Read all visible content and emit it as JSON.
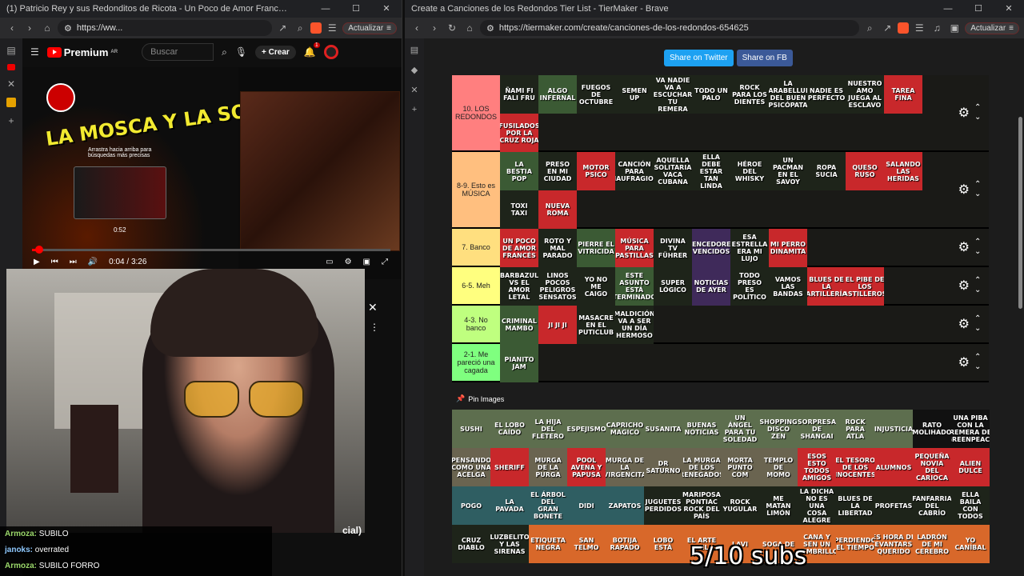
{
  "left_window": {
    "title": "(1) Patricio Rey y sus Redonditos de Ricota - Un Poco de Amor Frances (Audio Oficial) - YouTube - Brave",
    "url": "https://ww...",
    "update_label": "Actualizar",
    "yt": {
      "premium_label": "Premium",
      "premium_region": "AR",
      "search_placeholder": "Buscar",
      "create_label": "Crear",
      "notif_count": "1",
      "video_title_art": "LA MOSCA Y LA SOPA",
      "tooltip": "Arrastra hacia arriba para búsquedas más precisas",
      "preview_time": "0:52",
      "time": "0:04 / 3:26",
      "progress": 0.02,
      "side_official": "cial)"
    },
    "chat": [
      {
        "user": "Armoza:",
        "msg": "SUBILO"
      },
      {
        "user": "janoks:",
        "msg": "overrated"
      },
      {
        "user": "Armoza:",
        "msg": "SUBILO FORRO"
      }
    ]
  },
  "right_window": {
    "title": "Create a Canciones de los Redondos Tier List - TierMaker - Brave",
    "url": "https://tiermaker.com/create/canciones-de-los-redondos-654625",
    "update_label": "Actualizar",
    "share_twitter": "Share on Twitter",
    "share_fb": "Share on FB",
    "pin_label": "Pin Images",
    "overlay_text": "5/10 subs",
    "tiers": [
      {
        "label": "10. LOS REDONDOS",
        "color": "#ff7f7f",
        "height": 96,
        "items": [
          {
            "t": "ÑAMI FI FALI FRU",
            "c": "t-dark"
          },
          {
            "t": "ALGO INFERNAL",
            "c": "t-jungle"
          },
          {
            "t": "FUEGOS DE OCTUBRE",
            "c": "t-dark"
          },
          {
            "t": "SEMEN UP",
            "c": "t-dark"
          },
          {
            "t": "VA NADIE VA A ESCUCHAR TU REMERA",
            "c": "t-dark"
          },
          {
            "t": "TODO UN PALO",
            "c": "t-dark"
          },
          {
            "t": "ROCK PARA LOS DIENTES",
            "c": "t-dark"
          },
          {
            "t": "LA PARABELLUM DEL BUEN PSICÓPATA",
            "c": "t-dark"
          },
          {
            "t": "NADIE ES PERFECTO",
            "c": "t-dark"
          },
          {
            "t": "NUESTRO AMO JUEGA AL ESCLAVO",
            "c": "t-dark"
          },
          {
            "t": "TAREA FINA",
            "c": "t-red"
          },
          {
            "t": "FUSILADOS POR LA CRUZ ROJA",
            "c": "t-red"
          }
        ]
      },
      {
        "label": "8-9. Esto es MÚSICA",
        "color": "#ffbf7f",
        "height": 96,
        "items": [
          {
            "t": "LA BESTIA POP",
            "c": "t-jungle"
          },
          {
            "t": "PRESO EN MI CIUDAD",
            "c": "t-dark"
          },
          {
            "t": "MOTOR PSICO",
            "c": "t-red"
          },
          {
            "t": "CANCIÓN PARA NAUFRAGIOS",
            "c": "t-dark"
          },
          {
            "t": "AQUELLA SOLITARIA VACA CUBANA",
            "c": "t-dark"
          },
          {
            "t": "ELLA DEBE ESTAR TAN LINDA",
            "c": "t-dark"
          },
          {
            "t": "HÉROE DEL WHISKY",
            "c": "t-dark"
          },
          {
            "t": "UN PACMAN EN EL SAVOY",
            "c": "t-dark"
          },
          {
            "t": "ROPA SUCIA",
            "c": "t-dark"
          },
          {
            "t": "QUESO RUSO",
            "c": "t-red"
          },
          {
            "t": "SALANDO LAS HERIDAS",
            "c": "t-red"
          },
          {
            "t": "TOXI TAXI",
            "c": "t-dark"
          },
          {
            "t": "NUEVA ROMA",
            "c": "t-red"
          }
        ]
      },
      {
        "label": "7. Banco",
        "color": "#ffdf7f",
        "height": 48,
        "items": [
          {
            "t": "UN POCO DE AMOR FRANCÉS",
            "c": "t-red"
          },
          {
            "t": "ROTO Y MAL PARADO",
            "c": "t-dark"
          },
          {
            "t": "PIERRE EL VITRICIDA",
            "c": "t-jungle"
          },
          {
            "t": "MÚSICA PARA PASTILLAS",
            "c": "t-red"
          },
          {
            "t": "DIVINA TV FÜHRER",
            "c": "t-dark"
          },
          {
            "t": "VENCEDORES VENCIDOS",
            "c": "t-purple"
          },
          {
            "t": "ESA ESTRELLA ERA MI LUJO",
            "c": "t-dark"
          },
          {
            "t": "MI PERRO DINAMITA",
            "c": "t-red"
          }
        ]
      },
      {
        "label": "6-5. Meh",
        "color": "#ffff7f",
        "height": 48,
        "items": [
          {
            "t": "BARBAZUL VS EL AMOR LETAL",
            "c": "t-dark"
          },
          {
            "t": "LINOS POCOS PELIGROS SENSATOS",
            "c": "t-dark"
          },
          {
            "t": "YO NO ME CAIGO",
            "c": "t-dark"
          },
          {
            "t": "ESTE ASUNTO ESTÁ TERMINADO",
            "c": "t-jungle"
          },
          {
            "t": "SUPER LÓGICO",
            "c": "t-dark"
          },
          {
            "t": "NOTICIAS DE AYER",
            "c": "t-purple"
          },
          {
            "t": "TODO PRESO ES POLÍTICO",
            "c": "t-dark"
          },
          {
            "t": "VAMOS LAS BANDAS",
            "c": "t-dark"
          },
          {
            "t": "BLUES DE LA ARTILLERÍA",
            "c": "t-red"
          },
          {
            "t": "EL PIBE DE LOS ASTILLEROS",
            "c": "t-red"
          }
        ]
      },
      {
        "label": "4-3. No banco",
        "color": "#bfff7f",
        "height": 48,
        "items": [
          {
            "t": "CRIMINAL MAMBO",
            "c": "t-jungle"
          },
          {
            "t": "JI JI JI",
            "c": "t-red"
          },
          {
            "t": "MASACRE EN EL PUTICLUB",
            "c": "t-dark"
          },
          {
            "t": "MALDICIÓN VA A SER UN DÍA HERMOSO",
            "c": "t-dark"
          }
        ]
      },
      {
        "label": "2-1. Me pareció una cagada",
        "color": "#7fff7f",
        "height": 48,
        "items": [
          {
            "t": "PIANITO JAM",
            "c": "t-jungle"
          }
        ]
      }
    ],
    "pool": [
      {
        "t": "SUSHI",
        "c": "t-green"
      },
      {
        "t": "EL LOBO CAÍDO",
        "c": "t-green"
      },
      {
        "t": "LA HIJA DEL FLETERO",
        "c": "t-green"
      },
      {
        "t": "ESPEJISMO",
        "c": "t-green"
      },
      {
        "t": "CAPRICHO MAGICO",
        "c": "t-green"
      },
      {
        "t": "SUSANITA",
        "c": "t-green"
      },
      {
        "t": "BUENAS NOTICIAS",
        "c": "t-green"
      },
      {
        "t": "UN ÁNGEL PARA TU SOLEDAD",
        "c": "t-green"
      },
      {
        "t": "SHOPPING DISCO ZEN",
        "c": "t-green"
      },
      {
        "t": "SORPRESA DE SHANGAI",
        "c": "t-green"
      },
      {
        "t": "ROCK PARA ATLA",
        "c": "t-green"
      },
      {
        "t": "INJUSTICIA",
        "c": "t-green"
      },
      {
        "t": "RATO MOLIHADO",
        "c": "t-black"
      },
      {
        "t": "UNA PIBA CON LA REMERA DE GREENPEACE",
        "c": "t-black"
      },
      {
        "t": "PENSANDO COMO UNA ACELGA",
        "c": "t-sand"
      },
      {
        "t": "SHERIFF",
        "c": "t-red"
      },
      {
        "t": "MURGA DE LA PURGA",
        "c": "t-sand"
      },
      {
        "t": "POOL AVENA Y PAPUSA",
        "c": "t-red"
      },
      {
        "t": "MURGA DE LA VIRGENCITA",
        "c": "t-sand"
      },
      {
        "t": "DR SATURNO",
        "c": "t-sand"
      },
      {
        "t": "LA MURGA DE LOS RENEGADOS",
        "c": "t-sand"
      },
      {
        "t": "MORTA PUNTO COM",
        "c": "t-sand"
      },
      {
        "t": "TEMPLO DE MOMO",
        "c": "t-sand"
      },
      {
        "t": "ESOS ESTO TODOS AMIGOS",
        "c": "t-red"
      },
      {
        "t": "EL TESORO DE LOS INOCENTES",
        "c": "t-red"
      },
      {
        "t": "ALUMNOS",
        "c": "t-red"
      },
      {
        "t": "PEQUEÑA NOVIA DEL CARIOCA",
        "c": "t-red"
      },
      {
        "t": "ALIEN DULCE",
        "c": "t-red"
      },
      {
        "t": "POGO",
        "c": "t-teal"
      },
      {
        "t": "LA PAVADA",
        "c": "t-teal"
      },
      {
        "t": "EL ÁRBOL DEL GRAN BONETE",
        "c": "t-teal"
      },
      {
        "t": "DIDI",
        "c": "t-teal"
      },
      {
        "t": "ZAPATOS",
        "c": "t-teal"
      },
      {
        "t": "JUGUETES PERDIDOS",
        "c": "t-dark"
      },
      {
        "t": "MARIPOSA PONTIAC ROCK DEL PAÍS",
        "c": "t-dark"
      },
      {
        "t": "ROCK YUGULAR",
        "c": "t-dark"
      },
      {
        "t": "ME MATAN LIMÓN",
        "c": "t-dark"
      },
      {
        "t": "LA DICHA NO ES UNA COSA ALEGRE",
        "c": "t-dark"
      },
      {
        "t": "BLUES DE LA LIBERTAD",
        "c": "t-dark"
      },
      {
        "t": "PROFETAS",
        "c": "t-dark"
      },
      {
        "t": "FANFARRIA DEL CABRÍO",
        "c": "t-dark"
      },
      {
        "t": "ELLA BAILA CON TODOS",
        "c": "t-dark"
      },
      {
        "t": "CRUZ DIABLO",
        "c": "t-dark"
      },
      {
        "t": "LUZBELITO Y LAS SIRENAS",
        "c": "t-dark"
      },
      {
        "t": "ETIQUETA NEGRA",
        "c": "t-orange"
      },
      {
        "t": "SAN TELMO",
        "c": "t-orange"
      },
      {
        "t": "BOTIJA RAPADO",
        "c": "t-orange"
      },
      {
        "t": "LOBO ESTÁ",
        "c": "t-orange"
      },
      {
        "t": "EL ARTE DEL",
        "c": "t-orange"
      },
      {
        "t": "LAVI",
        "c": "t-orange"
      },
      {
        "t": "SOGA DE",
        "c": "t-orange"
      },
      {
        "t": "CANA Y SEN UN MEMBRILLO",
        "c": "t-orange"
      },
      {
        "t": "PERDIENDO EL TIEMPO",
        "c": "t-orange"
      },
      {
        "t": "ES HORA DE LEVANTARSE QUERIDO",
        "c": "t-orange"
      },
      {
        "t": "LADRÓN DE MI CEREBRO",
        "c": "t-orange"
      },
      {
        "t": "YO CANÍBAL",
        "c": "t-orange"
      }
    ]
  }
}
